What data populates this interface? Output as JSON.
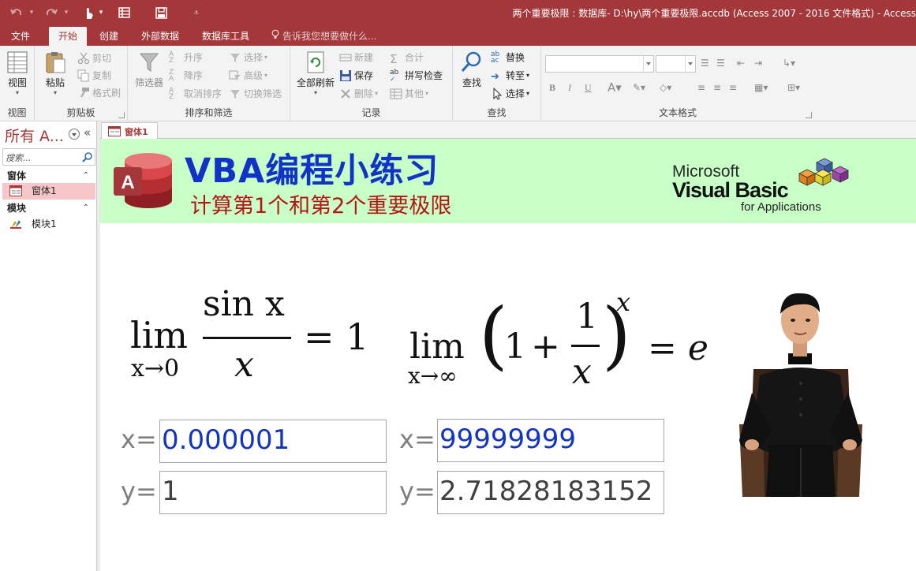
{
  "window": {
    "title": "两个重要极限 : 数据库- D:\\hy\\两个重要极限.accdb (Access 2007 - 2016 文件格式) - Access"
  },
  "quick_access": {
    "icons": [
      "undo-icon",
      "redo-icon",
      "touch-mode-icon",
      "view-icon",
      "save-icon",
      "customize-icon"
    ]
  },
  "tabs": [
    {
      "label": "文件"
    },
    {
      "label": "开始",
      "active": true
    },
    {
      "label": "创建"
    },
    {
      "label": "外部数据"
    },
    {
      "label": "数据库工具"
    }
  ],
  "tell_me": {
    "placeholder": "告诉我您想要做什么..."
  },
  "ribbon": {
    "views": {
      "label": "视图",
      "button": "视图"
    },
    "clipboard": {
      "label": "剪贴板",
      "paste": "粘贴",
      "cut": "剪切",
      "copy": "复制",
      "format_painter": "格式刷"
    },
    "sort_filter": {
      "label": "排序和筛选",
      "filter": "筛选器",
      "asc": "升序",
      "desc": "降序",
      "clear_sort": "取消排序",
      "selection": "选择",
      "advanced": "高级",
      "toggle": "切换筛选"
    },
    "records": {
      "label": "记录",
      "refresh_all": "全部刷新",
      "new": "新建",
      "save": "保存",
      "delete": "删除",
      "totals": "合计",
      "spelling": "拼写检查",
      "more": "其他"
    },
    "find": {
      "label": "查找",
      "find": "查找",
      "replace": "替换",
      "goto": "转至",
      "select": "选择"
    },
    "text_format": {
      "label": "文本格式",
      "bold": "B",
      "italic": "I",
      "underline": "U"
    }
  },
  "nav": {
    "title": "所有 A...",
    "search_placeholder": "搜索...",
    "sections": [
      {
        "label": "窗体",
        "items": [
          {
            "label": "窗体1",
            "selected": true
          }
        ]
      },
      {
        "label": "模块",
        "items": [
          {
            "label": "模块1",
            "selected": false
          }
        ]
      }
    ]
  },
  "doc_tab": {
    "label": "窗体1"
  },
  "form": {
    "banner_title": "VBA编程小练习",
    "banner_subtitle": "计算第1个和第2个重要极限",
    "vba_logo": {
      "microsoft": "Microsoft",
      "visual_basic": "Visual Basic",
      "for_apps": "for Applications"
    },
    "formula1": {
      "lim": "lim",
      "sub": "x→0",
      "numer": "sin x",
      "denom": "x",
      "rhs": "= 1"
    },
    "formula2": {
      "lim": "lim",
      "sub": "x→∞",
      "one": "1",
      "plus": "+",
      "frac_num": "1",
      "frac_den": "x",
      "exp": "x",
      "rhs": "= e"
    },
    "left": {
      "x_label": "x=",
      "x_value": "0.000001",
      "y_label": "y=",
      "y_value": "1"
    },
    "right": {
      "x_label": "x=",
      "x_value": "99999999",
      "y_label": "y=",
      "y_value": "2.71828183152"
    }
  },
  "colors": {
    "accent": "#a4373a",
    "banner_bg": "#c7ffc7",
    "title_blue": "#1233c8",
    "subtitle_red": "#b51515"
  }
}
